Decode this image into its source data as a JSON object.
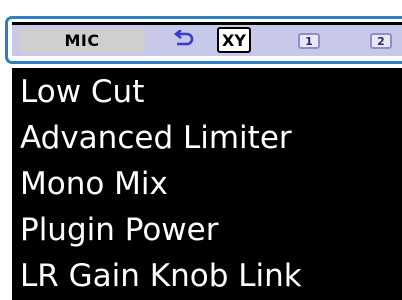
{
  "topbar": {
    "mic_label": "MIC",
    "back_icon": "return-arrow-icon",
    "xy_label": "XY",
    "track1_label": "1",
    "track2_label": "2"
  },
  "menu": {
    "items": [
      {
        "label": "Low Cut"
      },
      {
        "label": "Advanced Limiter"
      },
      {
        "label": "Mono Mix"
      },
      {
        "label": "Plugin Power"
      },
      {
        "label": "LR Gain Knob Link"
      }
    ]
  },
  "colors": {
    "frame_accent": "#2f7fc3",
    "topbar_bg": "#c8c8e8",
    "menu_bg": "#000000",
    "menu_text": "#ffffff",
    "back_icon": "#3a3ad0"
  }
}
